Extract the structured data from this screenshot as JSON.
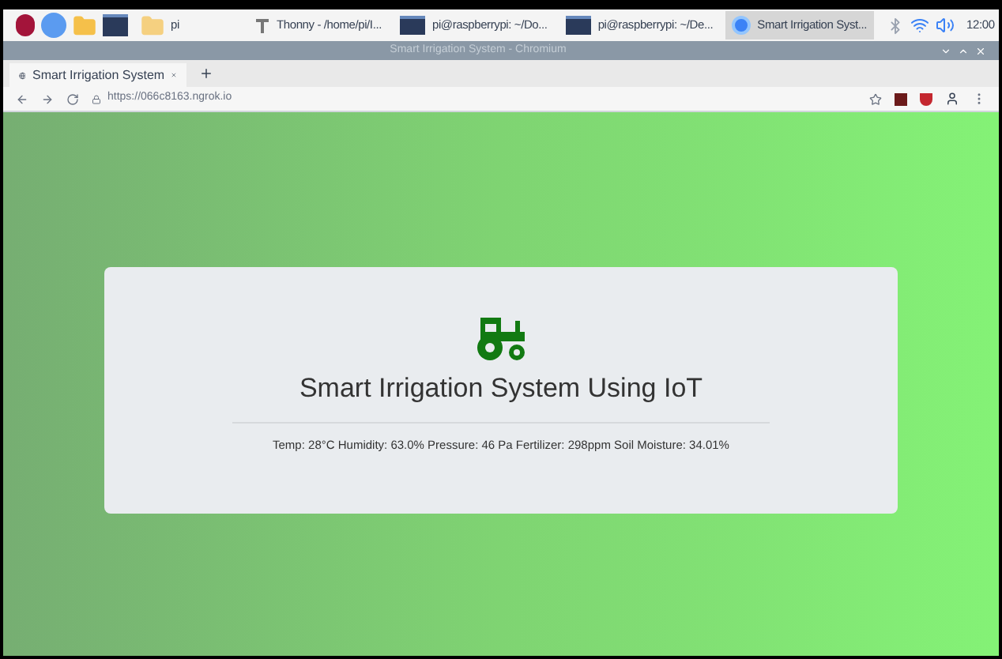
{
  "taskbar": {
    "folder_label": "pi",
    "tasks": [
      {
        "kind": "thonny",
        "label": "Thonny - /home/pi/I...",
        "selected": false
      },
      {
        "kind": "terminal",
        "label": "pi@raspberrypi: ~/Do...",
        "selected": false
      },
      {
        "kind": "terminal",
        "label": "pi@raspberrypi: ~/De...",
        "selected": false
      },
      {
        "kind": "chromium",
        "label": "Smart Irrigation Syst...",
        "selected": true
      }
    ],
    "clock": "12:00"
  },
  "window": {
    "title": "Smart Irrigation System - Chromium"
  },
  "tabs": [
    {
      "label": "Smart Irrigation System",
      "selected": true
    }
  ],
  "address_bar": {
    "url": "https://066c8163.ngrok.io"
  },
  "card": {
    "heading": "Smart Irrigation System Using IoT",
    "readings": "Temp: 28°C Humidity: 63.0% Pressure: 46 Pa Fertilizer: 298ppm Soil Moisture: 34.01%"
  }
}
